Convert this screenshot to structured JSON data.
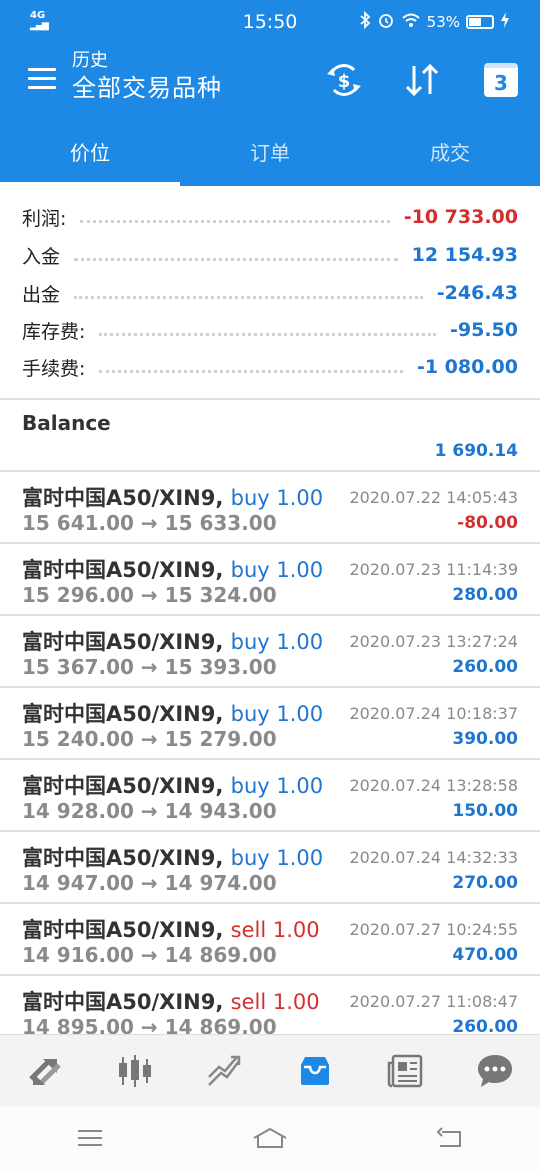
{
  "status_bar": {
    "network": "4G",
    "time": "15:50",
    "battery": "53%"
  },
  "header": {
    "subtitle": "历史",
    "title": "全部交易品种",
    "calendar_day": "3"
  },
  "tabs": [
    {
      "label": "价位",
      "active": true
    },
    {
      "label": "订单",
      "active": false
    },
    {
      "label": "成交",
      "active": false
    }
  ],
  "summary": [
    {
      "label": "利润:",
      "value": "-10 733.00"
    },
    {
      "label": "入金",
      "value": "12 154.93"
    },
    {
      "label": "出金",
      "value": "-246.43"
    },
    {
      "label": "库存费:",
      "value": "-95.50"
    },
    {
      "label": "手续费:",
      "value": "-1 080.00"
    }
  ],
  "balance": {
    "title": "Balance",
    "value": "1 690.14"
  },
  "trades": [
    {
      "symbol": "富时中国A50/XIN9,",
      "side": "buy 1.00",
      "prices": "15 641.00 → 15 633.00",
      "datetime": "2020.07.22 14:05:43",
      "profit": "-80.00"
    },
    {
      "symbol": "富时中国A50/XIN9,",
      "side": "buy 1.00",
      "prices": "15 296.00 → 15 324.00",
      "datetime": "2020.07.23 11:14:39",
      "profit": "280.00"
    },
    {
      "symbol": "富时中国A50/XIN9,",
      "side": "buy 1.00",
      "prices": "15 367.00 → 15 393.00",
      "datetime": "2020.07.23 13:27:24",
      "profit": "260.00"
    },
    {
      "symbol": "富时中国A50/XIN9,",
      "side": "buy 1.00",
      "prices": "15 240.00 → 15 279.00",
      "datetime": "2020.07.24 10:18:37",
      "profit": "390.00"
    },
    {
      "symbol": "富时中国A50/XIN9,",
      "side": "buy 1.00",
      "prices": "14 928.00 → 14 943.00",
      "datetime": "2020.07.24 13:28:58",
      "profit": "150.00"
    },
    {
      "symbol": "富时中国A50/XIN9,",
      "side": "buy 1.00",
      "prices": "14 947.00 → 14 974.00",
      "datetime": "2020.07.24 14:32:33",
      "profit": "270.00"
    },
    {
      "symbol": "富时中国A50/XIN9,",
      "side": "sell 1.00",
      "prices": "14 916.00 → 14 869.00",
      "datetime": "2020.07.27 10:24:55",
      "profit": "470.00"
    },
    {
      "symbol": "富时中国A50/XIN9,",
      "side": "sell 1.00",
      "prices": "14 895.00 → 14 869.00",
      "datetime": "2020.07.27 11:08:47",
      "profit": "260.00"
    }
  ],
  "bottom_nav": [
    {
      "icon": "trade-arrows-icon",
      "active": false
    },
    {
      "icon": "candlestick-chart-icon",
      "active": false
    },
    {
      "icon": "trend-lines-icon",
      "active": false
    },
    {
      "icon": "inbox-icon",
      "active": true
    },
    {
      "icon": "news-icon",
      "active": false
    },
    {
      "icon": "chat-bubble-icon",
      "active": false
    }
  ],
  "colors": {
    "primary": "#1e88e5",
    "positive": "#1e76d0",
    "negative": "#d32f2f",
    "muted": "#8a8a8a"
  }
}
